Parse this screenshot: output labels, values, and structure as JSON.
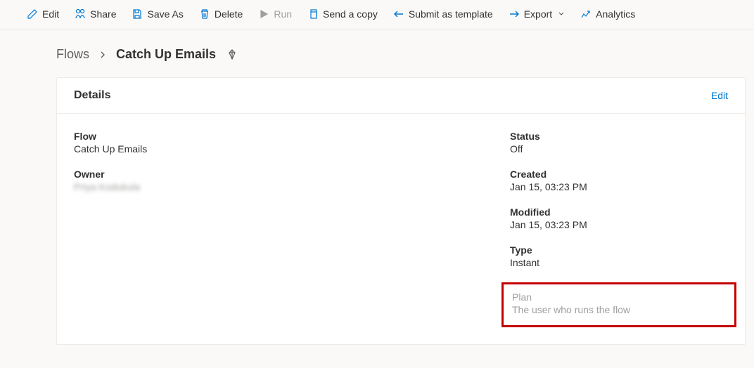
{
  "toolbar": {
    "edit": "Edit",
    "share": "Share",
    "saveAs": "Save As",
    "delete": "Delete",
    "run": "Run",
    "sendCopy": "Send a copy",
    "submitTemplate": "Submit as template",
    "export": "Export",
    "analytics": "Analytics"
  },
  "breadcrumb": {
    "root": "Flows",
    "current": "Catch Up Emails"
  },
  "card": {
    "title": "Details",
    "editLabel": "Edit"
  },
  "details": {
    "flowLabel": "Flow",
    "flowValue": "Catch Up Emails",
    "ownerLabel": "Owner",
    "ownerValue": "Priya Kodukula",
    "statusLabel": "Status",
    "statusValue": "Off",
    "createdLabel": "Created",
    "createdValue": "Jan 15, 03:23 PM",
    "modifiedLabel": "Modified",
    "modifiedValue": "Jan 15, 03:23 PM",
    "typeLabel": "Type",
    "typeValue": "Instant",
    "planLabel": "Plan",
    "planValue": "The user who runs the flow"
  }
}
